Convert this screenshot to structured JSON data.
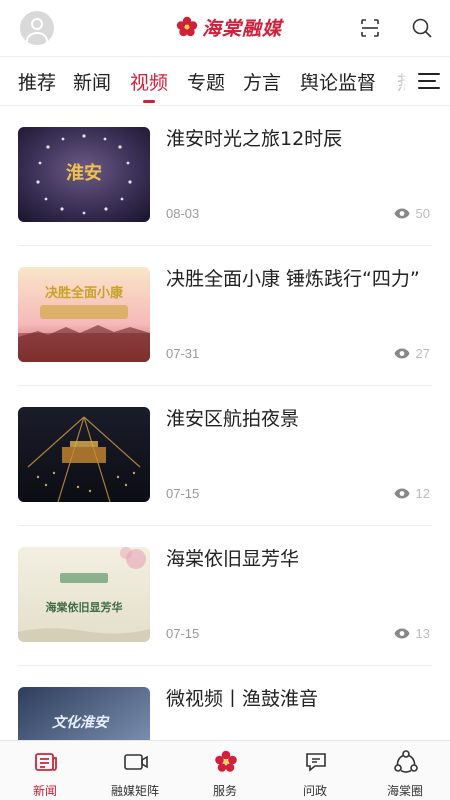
{
  "header": {
    "logo_text": "海棠融媒",
    "logo_icon": "begonia-flower-icon",
    "avatar_icon": "user-avatar-icon",
    "scan_icon": "scan-icon",
    "search_icon": "search-icon"
  },
  "tabs": [
    {
      "label": "推荐",
      "active": false
    },
    {
      "label": "新闻",
      "active": false
    },
    {
      "label": "视频",
      "active": true
    },
    {
      "label": "专题",
      "active": false
    },
    {
      "label": "方言",
      "active": false
    },
    {
      "label": "舆论监督",
      "active": false
    },
    {
      "label": "热",
      "active": false
    }
  ],
  "videos": [
    {
      "title": "淮安时光之旅12时辰",
      "date": "08-03",
      "views": "50",
      "thumb_text": "淮安"
    },
    {
      "title": "决胜全面小康 锤炼践行“四力”",
      "date": "07-31",
      "views": "27",
      "thumb_text": "决胜全面小康"
    },
    {
      "title": "淮安区航拍夜景",
      "date": "07-15",
      "views": "12",
      "thumb_text": ""
    },
    {
      "title": "海棠依旧显芳华",
      "date": "07-15",
      "views": "13",
      "thumb_text": "海棠依旧显芳华"
    },
    {
      "title": "微视频丨渔鼓淮音",
      "date": "",
      "views": "",
      "thumb_text": "文化淮安"
    }
  ],
  "bottom_nav": [
    {
      "label": "新闻",
      "icon": "news-icon",
      "active": true
    },
    {
      "label": "融媒矩阵",
      "icon": "video-camera-icon",
      "active": false
    },
    {
      "label": "服务",
      "icon": "begonia-flower-icon",
      "active": false
    },
    {
      "label": "问政",
      "icon": "chat-icon",
      "active": false
    },
    {
      "label": "海棠圈",
      "icon": "circle-community-icon",
      "active": false
    }
  ],
  "colors": {
    "accent": "#d3203a",
    "text": "#222222",
    "muted": "#999999"
  }
}
